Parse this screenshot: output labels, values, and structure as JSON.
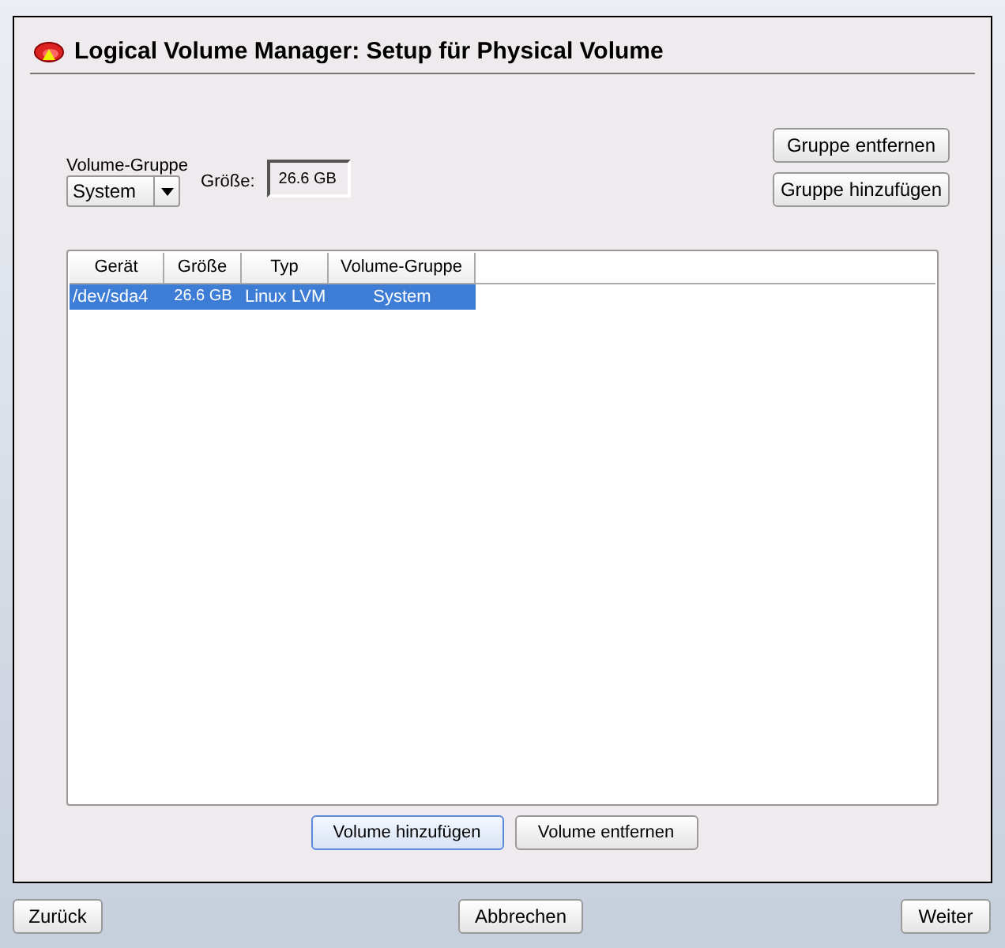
{
  "window": {
    "title": "Logical Volume Manager: Setup für Physical Volume"
  },
  "volume_group": {
    "label": "Volume-Gruppe",
    "value": "System"
  },
  "size": {
    "label": "Größe:",
    "value": "26.6 GB"
  },
  "group_buttons": [
    "Gruppe entfernen",
    "Gruppe hinzufügen"
  ],
  "table": {
    "columns": [
      "Gerät",
      "Größe",
      "Typ",
      "Volume-Gruppe"
    ],
    "rows": [
      {
        "cells": [
          "/dev/sda4",
          "26.6 GB",
          "Linux LVM",
          "System"
        ],
        "selected": true
      }
    ]
  },
  "volume_buttons": [
    {
      "label": "Volume hinzufügen",
      "focused": true
    },
    {
      "label": "Volume entfernen",
      "focused": false
    }
  ],
  "nav_buttons": [
    "Zurück",
    "Abbrechen",
    "Weiter"
  ]
}
